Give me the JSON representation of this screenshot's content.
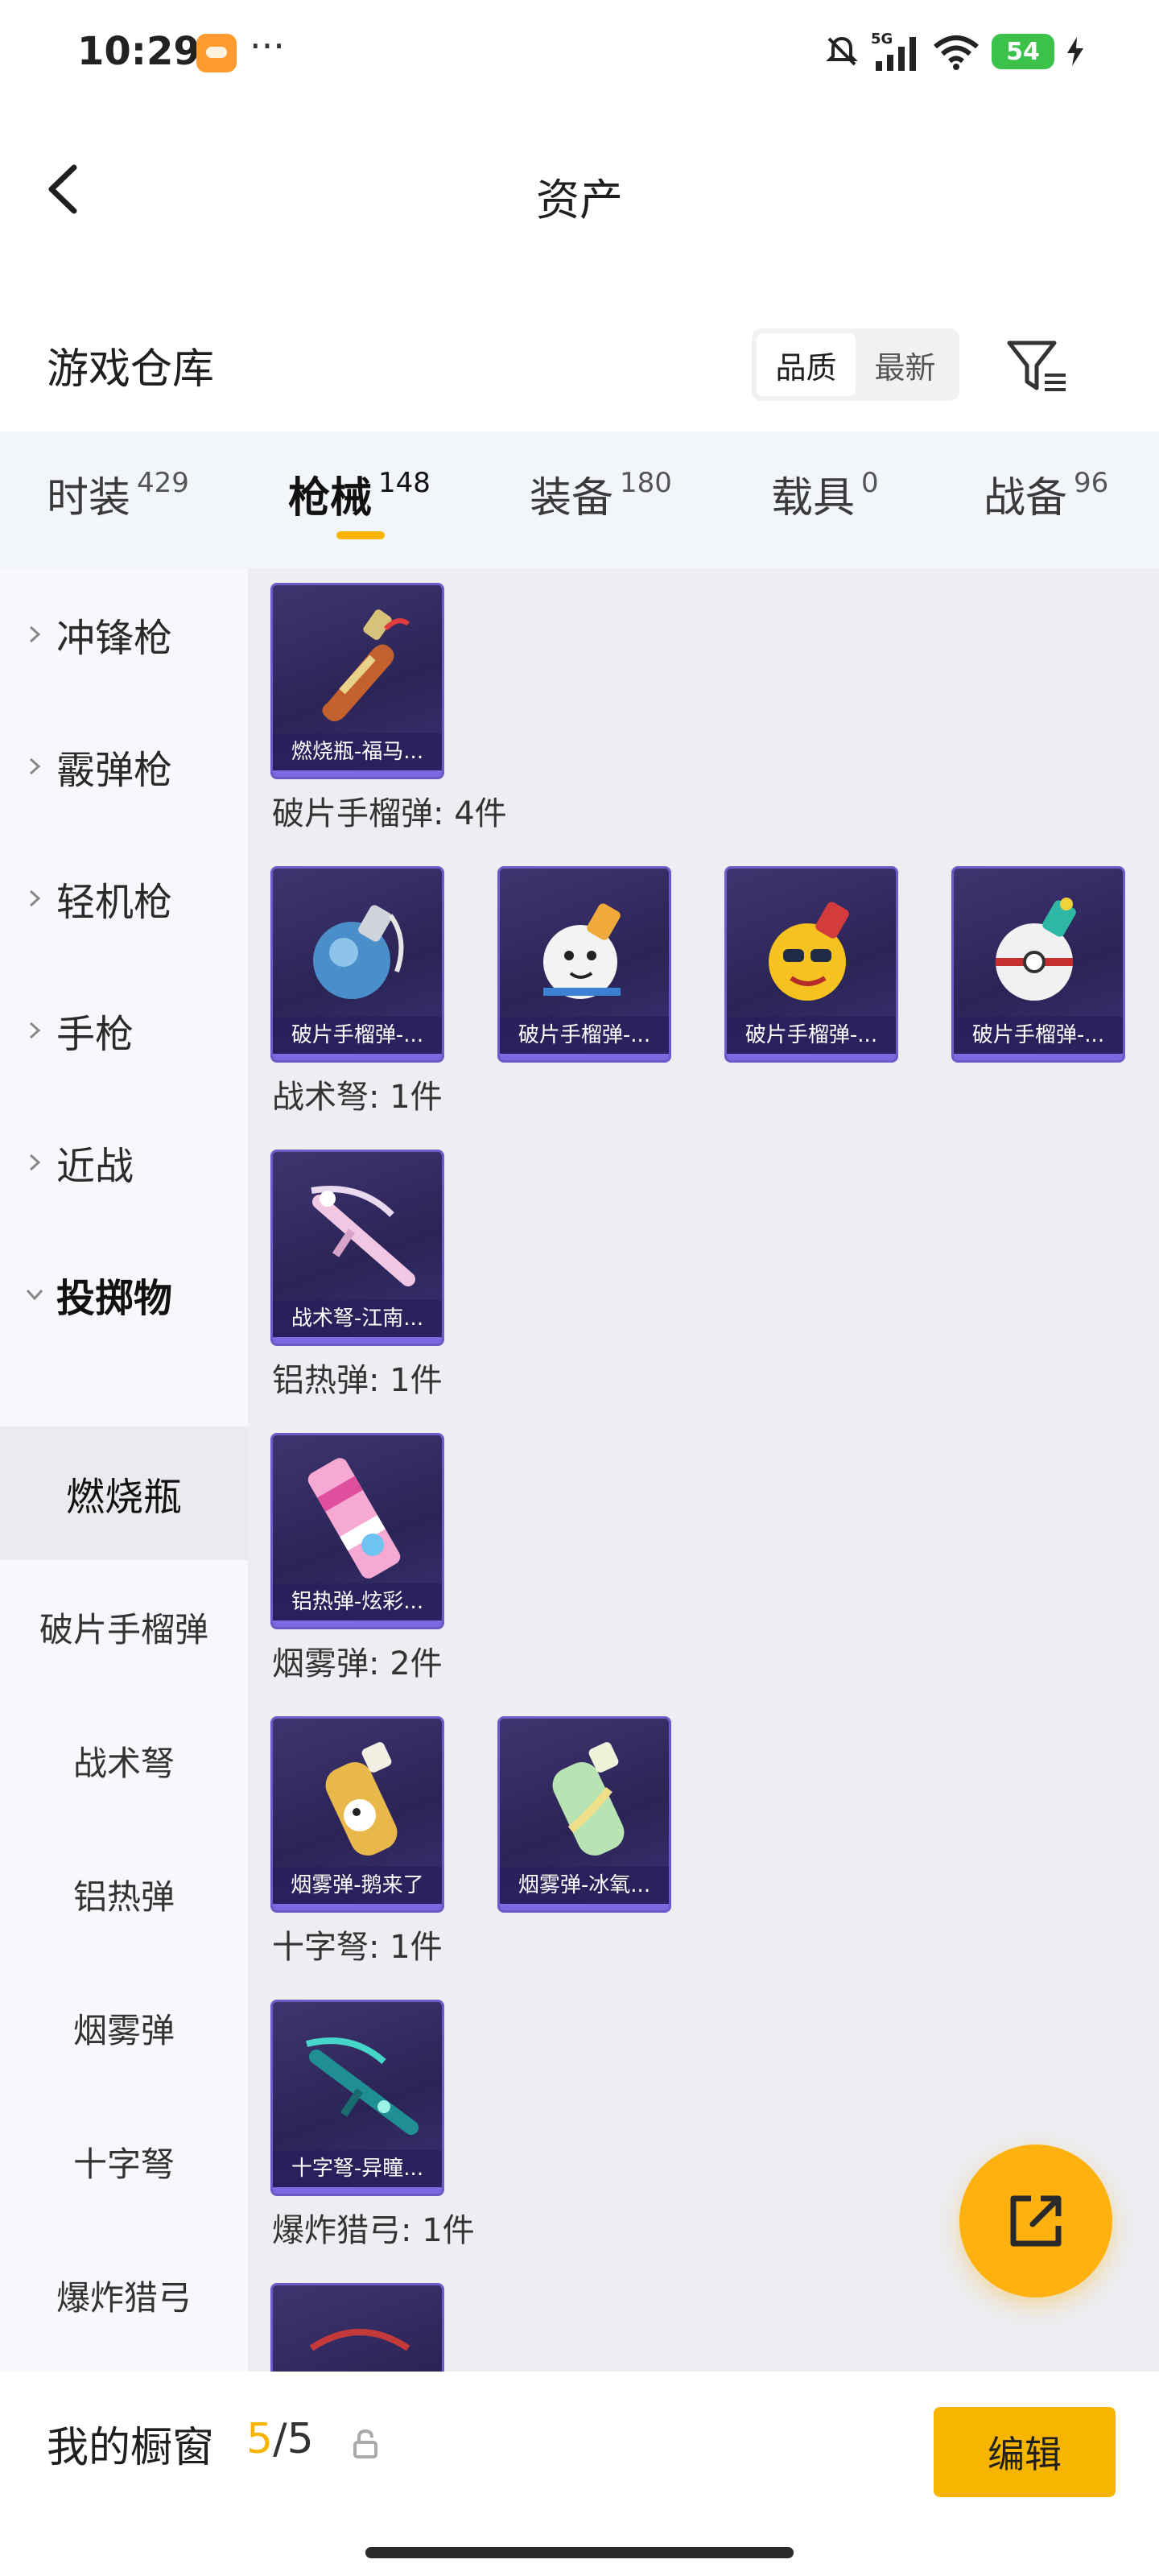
{
  "status_bar": {
    "time": "10:29",
    "battery": "54",
    "network": "5G"
  },
  "header": {
    "title": "资产"
  },
  "section": {
    "title": "游戏仓库",
    "sort_quality": "品质",
    "sort_newest": "最新"
  },
  "tabs": [
    {
      "label": "时装",
      "count": "429"
    },
    {
      "label": "枪械",
      "count": "148"
    },
    {
      "label": "装备",
      "count": "180"
    },
    {
      "label": "载具",
      "count": "0"
    },
    {
      "label": "战备",
      "count": "96"
    }
  ],
  "sidebar": {
    "categories": [
      "冲锋枪",
      "霰弹枪",
      "轻机枪",
      "手枪",
      "近战",
      "投掷物"
    ],
    "subitems": [
      "燃烧瓶",
      "破片手榴弹",
      "战术弩",
      "铝热弹",
      "烟雾弹",
      "十字弩",
      "爆炸猎弓"
    ]
  },
  "groups": [
    {
      "title": "破片手榴弹: 4件"
    },
    {
      "title": "战术弩: 1件"
    },
    {
      "title": "铝热弹: 1件"
    },
    {
      "title": "烟雾弹: 2件"
    },
    {
      "title": "十字弩: 1件"
    },
    {
      "title": "爆炸猎弓: 1件"
    }
  ],
  "cards": [
    {
      "label": "燃烧瓶-福马..."
    },
    {
      "label": "破片手榴弹-..."
    },
    {
      "label": "破片手榴弹-..."
    },
    {
      "label": "破片手榴弹-..."
    },
    {
      "label": "破片手榴弹-..."
    },
    {
      "label": "战术弩-江南..."
    },
    {
      "label": "铝热弹-炫彩..."
    },
    {
      "label": "烟雾弹-鹅来了"
    },
    {
      "label": "烟雾弹-冰氧..."
    },
    {
      "label": "十字弩-异瞳..."
    }
  ],
  "bottom": {
    "showcase_label": "我的橱窗",
    "showcase_current": "5",
    "showcase_sep": "/",
    "showcase_max": "5",
    "edit_label": "编辑"
  },
  "colors": {
    "accent": "#f7b500",
    "card_bg": "#2b2456",
    "card_border": "#6b5cc9"
  }
}
